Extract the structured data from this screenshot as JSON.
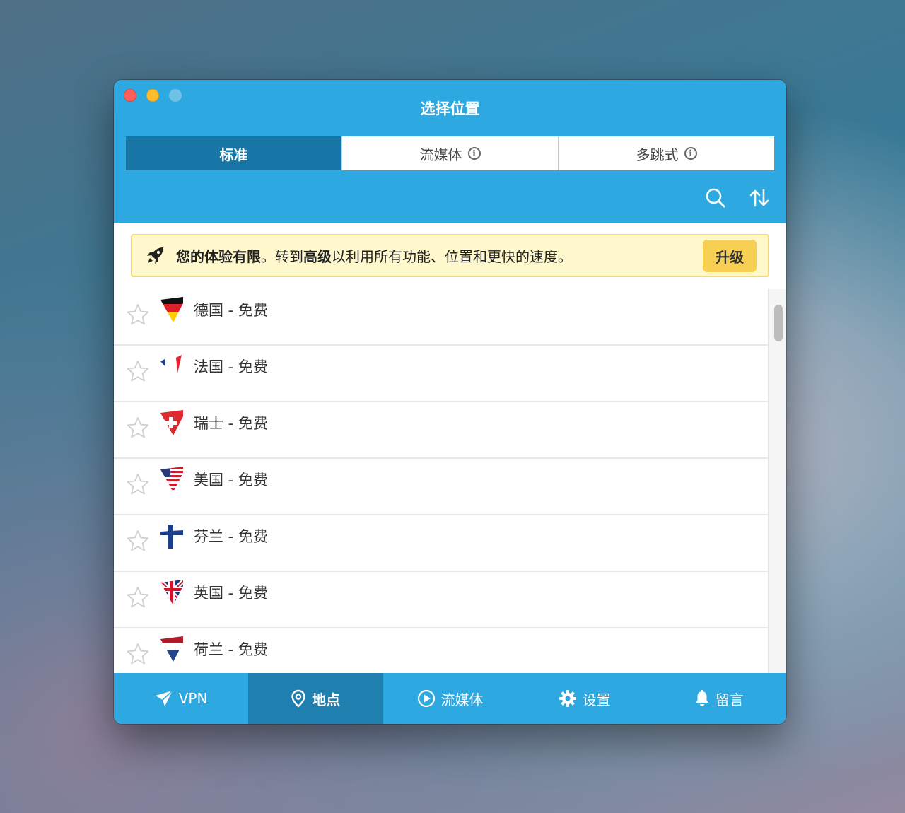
{
  "window": {
    "title": "选择位置"
  },
  "tabs": [
    {
      "label": "标准",
      "active": true
    },
    {
      "label": "流媒体",
      "active": false,
      "icon": "info-icon"
    },
    {
      "label": "多跳式",
      "active": false,
      "icon": "info-icon"
    }
  ],
  "toolbar": {
    "search_icon": "search-icon",
    "sort_icon": "sort-icon"
  },
  "banner": {
    "icon": "rocket-icon",
    "part1": "您的体验有限",
    "part2": "。转到",
    "part3": "高级",
    "part4": "以利用所有功能、位置和更快的速度。",
    "button_label": "升级",
    "button_color": "#f7cf52"
  },
  "locations": [
    {
      "label": "德国 - 免费",
      "flag": "germany-flag"
    },
    {
      "label": "法国 - 免费",
      "flag": "france-flag"
    },
    {
      "label": "瑞士 - 免费",
      "flag": "switzerland-flag"
    },
    {
      "label": "美国 - 免费",
      "flag": "usa-flag"
    },
    {
      "label": "芬兰 - 免费",
      "flag": "finland-flag"
    },
    {
      "label": "英国 - 免费",
      "flag": "uk-flag"
    },
    {
      "label": "荷兰 - 免费",
      "flag": "netherlands-flag"
    }
  ],
  "bottom_nav": [
    {
      "label": "VPN",
      "icon": "vpn-icon",
      "active": false
    },
    {
      "label": "地点",
      "icon": "location-pin-icon",
      "active": true
    },
    {
      "label": "流媒体",
      "icon": "play-icon",
      "active": false
    },
    {
      "label": "设置",
      "icon": "gear-icon",
      "active": false
    },
    {
      "label": "留言",
      "icon": "bell-icon",
      "active": false
    }
  ],
  "colors": {
    "brand": "#2ea8e0",
    "active_tab": "#1876a6",
    "banner_bg": "#fef8cc"
  }
}
